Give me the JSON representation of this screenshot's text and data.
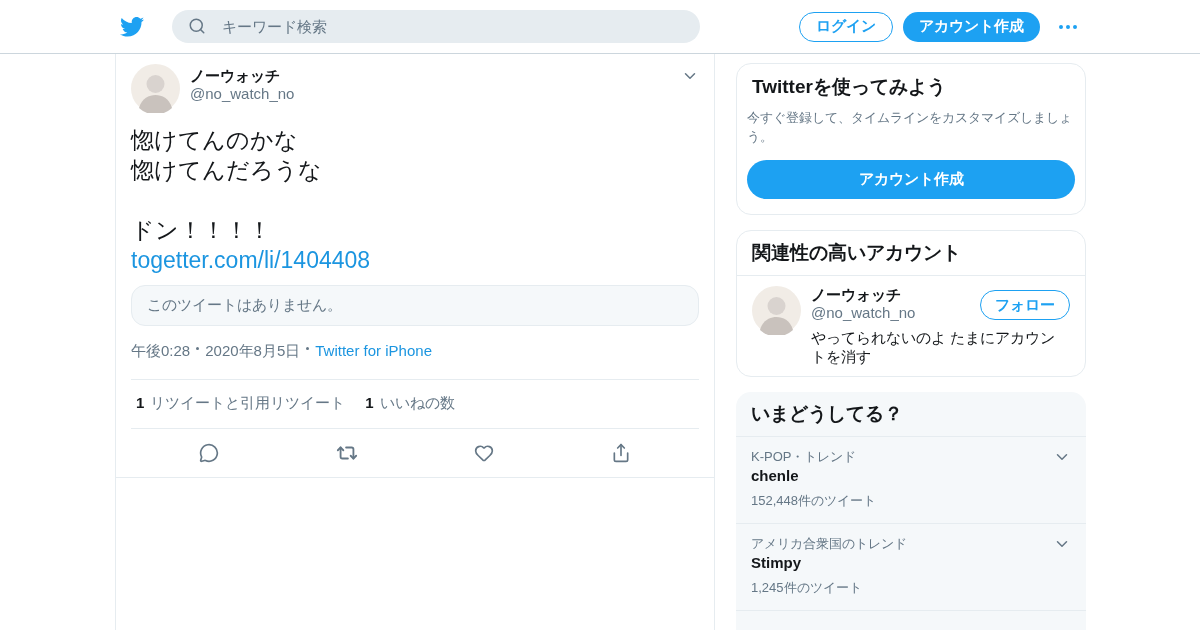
{
  "header": {
    "search": {
      "placeholder": "キーワード検索"
    },
    "login": "ログイン",
    "signup": "アカウント作成"
  },
  "tweet": {
    "name": "ノーウォッチ",
    "handle": "@no_watch_no",
    "paragraphs": [
      [
        "惚けてんのかな",
        "惚けてんだろうな"
      ],
      [
        "ドン！！！！"
      ]
    ],
    "link": "togetter.com/li/1404408",
    "quote_unavailable": "このツイートはありません。",
    "time": "午後0:28",
    "date": "2020年8月5日",
    "source": "Twitter for iPhone",
    "stats": [
      {
        "count": "1",
        "label": "リツイートと引用リツイート"
      },
      {
        "count": "1",
        "label": "いいねの数"
      }
    ]
  },
  "signup_card": {
    "title": "Twitterを使ってみよう",
    "text": "今すぐ登録して、タイムラインをカスタマイズしましょう。",
    "button": "アカウント作成"
  },
  "related": {
    "title": "関連性の高いアカウント",
    "accounts": [
      {
        "name": "ノーウォッチ",
        "handle": "@no_watch_no",
        "follow": "フォロー",
        "bio": "やってられないのよ たまにアカウントを消す"
      }
    ]
  },
  "trends": {
    "title": "いまどうしてる？",
    "items": [
      {
        "context": "K-POP・トレンド",
        "name": "chenle",
        "count": "152,448件のツイート"
      },
      {
        "context": "アメリカ合衆国のトレンド",
        "name": "Stimpy",
        "count": "1,245件のツイート"
      }
    ]
  }
}
